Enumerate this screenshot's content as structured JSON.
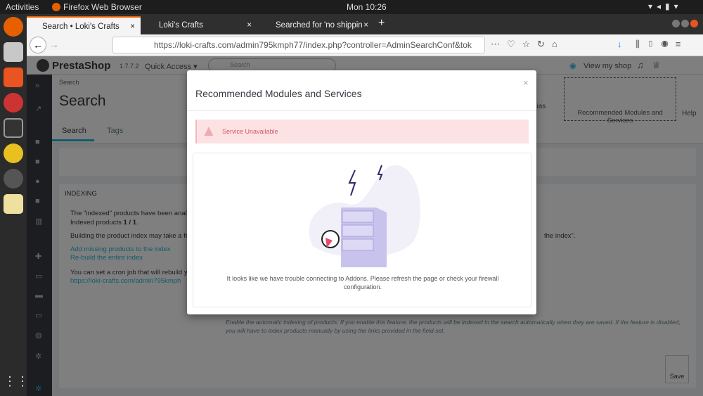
{
  "system": {
    "activities": "Activities",
    "app": "Firefox Web Browser",
    "clock": "Mon 10:26"
  },
  "browser": {
    "tabs": [
      {
        "label": "Search • Loki's Crafts"
      },
      {
        "label": "Loki's Crafts"
      },
      {
        "label": "Searched for 'no shippin"
      }
    ],
    "new_tab": "+",
    "url": "https://loki-crafts.com/admin795kmph77/index.php?controller=AdminSearchConf&tok"
  },
  "admin": {
    "logo": "PrestaShop",
    "version": "1.7.7.2",
    "quick_access": "Quick Access ▾",
    "search_placeholder": "Search",
    "view_shop": "View my shop",
    "breadcrumb": "Search",
    "title": "Search",
    "toolbar": {
      "add_alias": "Add new alias",
      "recommended": "Recommended Modules and Services",
      "help": "Help"
    },
    "tabs": [
      "Search",
      "Tags"
    ],
    "indexing": {
      "heading": "INDEXING",
      "line1": "The \"indexed\" products have been analy",
      "line2_prefix": "Indexed products ",
      "line2_value": "1 / 1",
      "line2_suffix": ".",
      "line3": "Building the product index may take a fe",
      "line3_end": "the index\".",
      "link1": "Add missing products to the index",
      "link2": "Re-build the entire index",
      "cron": "You can set a cron job that will rebuild yo",
      "cron_link": "https://loki-crafts.com/admin795kmph",
      "help_text": "Enable the automatic indexing of products. If you enable this feature, the products will be indexed in the search automatically when they are saved. If the feature is disabled, you will have to index products manually by using the links provided in the field set."
    },
    "save": "Save"
  },
  "modal": {
    "title": "Recommended Modules and Services",
    "close": "×",
    "alert": "Service Unavailable",
    "message": "It looks like we have trouble connecting to Addons. Please refresh the page or check your firewall configuration."
  }
}
